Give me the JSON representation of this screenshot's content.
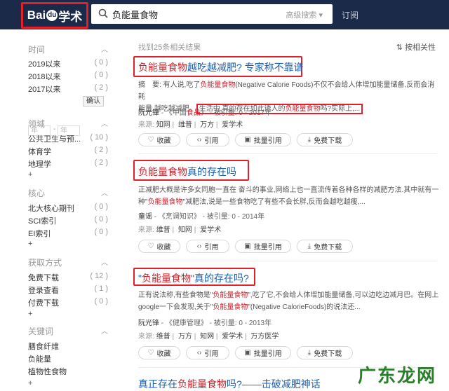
{
  "header": {
    "logo_text": "Bai",
    "logo_paw": "du",
    "logo_suffix": "学术",
    "search_value": "负能量食物",
    "advanced_search": "高级搜索",
    "subscribe": "订阅"
  },
  "sidebar": {
    "time": {
      "title": "时间",
      "items": [
        {
          "label": "2019以来",
          "count": "( 0 )"
        },
        {
          "label": "2018以来",
          "count": "( 0 )"
        },
        {
          "label": "2017以来",
          "count": "( 2 )"
        }
      ],
      "year_placeholder": "年",
      "dash": "-",
      "confirm": "确认"
    },
    "field": {
      "title": "领域",
      "items": [
        {
          "label": "公共卫生与预...",
          "count": "( 10 )"
        },
        {
          "label": "体育学",
          "count": "( 2 )"
        },
        {
          "label": "地理学",
          "count": "( 2 )"
        }
      ],
      "more": "+"
    },
    "core": {
      "title": "核心",
      "items": [
        {
          "label": "北大核心期刊",
          "count": "( 0 )"
        },
        {
          "label": "SCI索引",
          "count": "( 0 )"
        },
        {
          "label": "EI索引",
          "count": "( 0 )"
        }
      ],
      "more": "+"
    },
    "access": {
      "title": "获取方式",
      "items": [
        {
          "label": "免费下载",
          "count": "( 12 )"
        },
        {
          "label": "登录查看",
          "count": "( 1 )"
        },
        {
          "label": "付费下载",
          "count": "( 0 )"
        }
      ],
      "more": "+"
    },
    "keywords": {
      "title": "关键词",
      "items": [
        {
          "label": "膳食纤维"
        },
        {
          "label": "负能量"
        },
        {
          "label": "植物性食物"
        }
      ],
      "more": "+"
    }
  },
  "main": {
    "found": "找到25条相关结果",
    "sort": "按相关性",
    "buttons": {
      "collect": "收藏",
      "cite": "引用",
      "batch": "批量引用",
      "download": "免费下载"
    },
    "results": [
      {
        "title_hl": "负能量食物",
        "title_rest": "越吃越减肥? 专家称不靠谱",
        "abs_line1_a": "摘　要: 有人说,吃了",
        "abs_line1_hl": "负能量食物",
        "abs_line1_b": "(Negative Calorie Foods)不仅不会给人体增加能量储备,反而会消耗",
        "abs_line2_a": "能量,越吃越减肥。",
        "abs_line2_box_a": "生活中,真的存在如此诱人的",
        "abs_line2_box_hl": "负能量食物",
        "abs_line2_box_b": "吗?实际上,...",
        "author": "阮光锋",
        "dash": "-",
        "journal_a": "《中国",
        "journal_hl": "食品",
        "journal_b": "》",
        "cited": "被引量: 0",
        "year": "2017年",
        "source_label": "来源:",
        "sources": [
          "知网",
          "维普",
          "万方",
          "爱学术"
        ]
      },
      {
        "title_hl": "负能量食物",
        "title_rest": "真的存在吗",
        "abs_line1": "正减肥大概是许多女同胞一直在 奋斗的事业,网络上也一直流传着各种各样的减肥方法.其中就有一",
        "abs_line2_a": "种\"",
        "abs_line2_hl": "负能量食物",
        "abs_line2_b": "\"减肥法,说是一些食物吃了有些不会长胖,反而会越吃越瘦,...",
        "author": "童谣",
        "dash": "-",
        "journal": "《烹调知识》",
        "cited": "被引量: 0",
        "year": "2014年",
        "source_label": "来源:",
        "sources": [
          "维普",
          "知网",
          "爱学术"
        ]
      },
      {
        "title_a": "\"",
        "title_hl": "负能量食物",
        "title_rest": "\"真的存在吗?",
        "abs_line1_a": "正有说法称,有些食物是\"",
        "abs_line1_hl": "负能量食物",
        "abs_line1_b": "\",吃了它,不会给人体增加能量储备,可以边吃边减月巴。在网上",
        "abs_line2_a": "google一下会发现,关于\"",
        "abs_line2_hl": "负能量食物",
        "abs_line2_b": "\"(Negative CalorieFoods)的说法还...",
        "author": "阮光锋",
        "dash": "-",
        "journal": "《健康管理》",
        "cited": "被引量: 0",
        "year": "2013年",
        "source_label": "来源:",
        "sources": [
          "维普",
          "万方",
          "知网",
          "爱学术",
          "万方医学"
        ]
      },
      {
        "title_a": "真正存在",
        "title_hl": "负能量食物",
        "title_rest": "吗?——击破减肥神话"
      }
    ]
  },
  "watermark": "广东龙网",
  "colors": {
    "topbar": "#1c2a4a",
    "accent_red": "#e0202a",
    "link_blue": "#1a5fb4",
    "highlight": "#d0202a"
  }
}
